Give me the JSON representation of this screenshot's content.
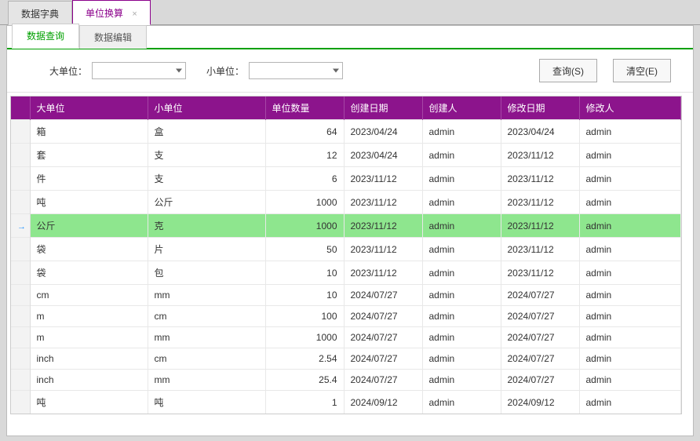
{
  "topTabs": {
    "items": [
      "数据字典",
      "单位换算"
    ],
    "activeIndex": 1
  },
  "innerTabs": {
    "items": [
      "数据查询",
      "数据编辑"
    ],
    "activeIndex": 0
  },
  "filters": {
    "bigUnitLabel": "大单位：",
    "smallUnitLabel": "小单位：",
    "bigUnitValue": "",
    "smallUnitValue": "",
    "queryButton": "查询(S)",
    "clearButton": "清空(E)"
  },
  "grid": {
    "headers": {
      "bigUnit": "大单位",
      "smallUnit": "小单位",
      "qty": "单位数量",
      "createDate": "创建日期",
      "creator": "创建人",
      "modifyDate": "修改日期",
      "modifier": "修改人"
    },
    "selectedIndex": 4,
    "rows": [
      {
        "bigUnit": "箱",
        "smallUnit": "盒",
        "qty": "64",
        "createDate": "2023/04/24",
        "creator": "admin",
        "modifyDate": "2023/04/24",
        "modifier": "admin"
      },
      {
        "bigUnit": "套",
        "smallUnit": "支",
        "qty": "12",
        "createDate": "2023/04/24",
        "creator": "admin",
        "modifyDate": "2023/11/12",
        "modifier": "admin"
      },
      {
        "bigUnit": "件",
        "smallUnit": "支",
        "qty": "6",
        "createDate": "2023/11/12",
        "creator": "admin",
        "modifyDate": "2023/11/12",
        "modifier": "admin"
      },
      {
        "bigUnit": "吨",
        "smallUnit": "公斤",
        "qty": "1000",
        "createDate": "2023/11/12",
        "creator": "admin",
        "modifyDate": "2023/11/12",
        "modifier": "admin"
      },
      {
        "bigUnit": "公斤",
        "smallUnit": "克",
        "qty": "1000",
        "createDate": "2023/11/12",
        "creator": "admin",
        "modifyDate": "2023/11/12",
        "modifier": "admin"
      },
      {
        "bigUnit": "袋",
        "smallUnit": "片",
        "qty": "50",
        "createDate": "2023/11/12",
        "creator": "admin",
        "modifyDate": "2023/11/12",
        "modifier": "admin"
      },
      {
        "bigUnit": "袋",
        "smallUnit": "包",
        "qty": "10",
        "createDate": "2023/11/12",
        "creator": "admin",
        "modifyDate": "2023/11/12",
        "modifier": "admin"
      },
      {
        "bigUnit": "cm",
        "smallUnit": "mm",
        "qty": "10",
        "createDate": "2024/07/27",
        "creator": "admin",
        "modifyDate": "2024/07/27",
        "modifier": "admin"
      },
      {
        "bigUnit": "m",
        "smallUnit": "cm",
        "qty": "100",
        "createDate": "2024/07/27",
        "creator": "admin",
        "modifyDate": "2024/07/27",
        "modifier": "admin"
      },
      {
        "bigUnit": "m",
        "smallUnit": "mm",
        "qty": "1000",
        "createDate": "2024/07/27",
        "creator": "admin",
        "modifyDate": "2024/07/27",
        "modifier": "admin"
      },
      {
        "bigUnit": "inch",
        "smallUnit": "cm",
        "qty": "2.54",
        "createDate": "2024/07/27",
        "creator": "admin",
        "modifyDate": "2024/07/27",
        "modifier": "admin"
      },
      {
        "bigUnit": "inch",
        "smallUnit": "mm",
        "qty": "25.4",
        "createDate": "2024/07/27",
        "creator": "admin",
        "modifyDate": "2024/07/27",
        "modifier": "admin"
      },
      {
        "bigUnit": "吨",
        "smallUnit": "吨",
        "qty": "1",
        "createDate": "2024/09/12",
        "creator": "admin",
        "modifyDate": "2024/09/12",
        "modifier": "admin"
      }
    ]
  }
}
